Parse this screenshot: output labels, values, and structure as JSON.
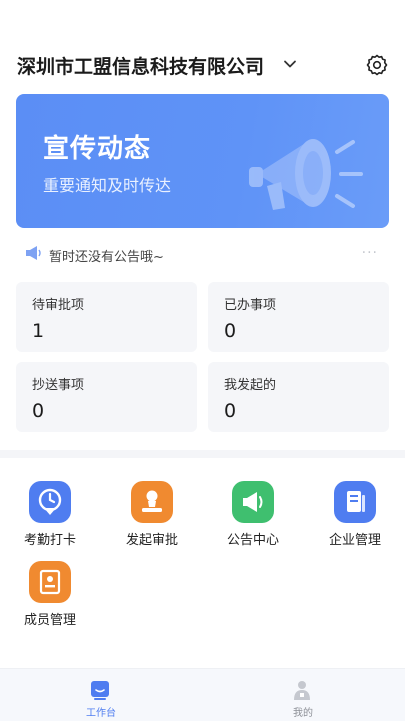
{
  "header": {
    "company": "深圳市工盟信息科技有限公司"
  },
  "banner": {
    "title": "宣传动态",
    "subtitle": "重要通知及时传达"
  },
  "notice": {
    "text": "暂时还没有公告哦~",
    "more": "···"
  },
  "stats": [
    {
      "label": "待审批项",
      "value": "1"
    },
    {
      "label": "已办事项",
      "value": "0"
    },
    {
      "label": "抄送事项",
      "value": "0"
    },
    {
      "label": "我发起的",
      "value": "0"
    }
  ],
  "apps": [
    {
      "label": "考勤打卡",
      "color": "#4f7df0",
      "icon": "location-pin-icon"
    },
    {
      "label": "发起审批",
      "color": "#f08a30",
      "icon": "approval-stamp-icon"
    },
    {
      "label": "公告中心",
      "color": "#3fbf6f",
      "icon": "megaphone-icon"
    },
    {
      "label": "企业管理",
      "color": "#4f7df0",
      "icon": "document-icon"
    },
    {
      "label": "成员管理",
      "color": "#f08a30",
      "icon": "member-book-icon"
    }
  ],
  "tabs": [
    {
      "label": "工作台",
      "active": true,
      "color": "#4f7df0"
    },
    {
      "label": "我的",
      "active": false,
      "color": "#8c8f96"
    }
  ]
}
